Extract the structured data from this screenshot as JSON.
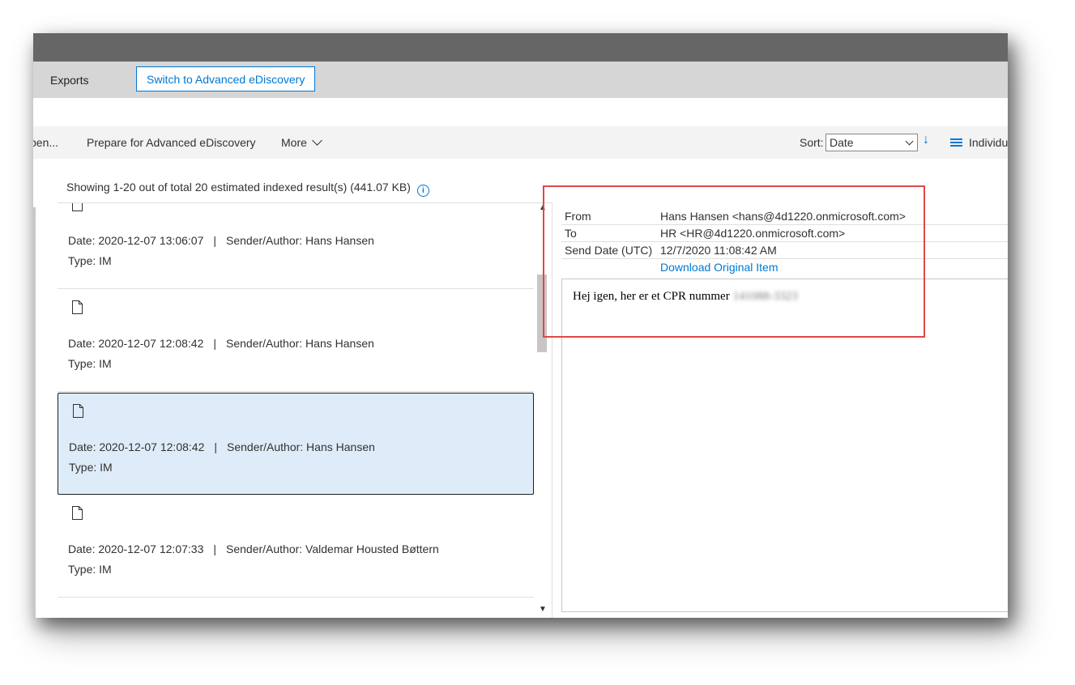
{
  "tabs": {
    "exports_label": "Exports",
    "switch_button_label": "Switch to Advanced eDiscovery"
  },
  "commands": {
    "open_label": "pen...",
    "prepare_label": "Prepare for Advanced eDiscovery",
    "more_label": "More",
    "sort_label": "Sort:",
    "sort_value": "Date",
    "view_label": "Individu"
  },
  "results": {
    "summary": "Showing 1-20 out of total 20 estimated indexed result(s) (441.07 KB)",
    "items": [
      {
        "meta_date": "Date: 2020-12-07 13:06:07",
        "sep": "|",
        "sender": "Sender/Author: Hans Hansen",
        "type": "Type: IM"
      },
      {
        "meta_date": "Date: 2020-12-07 12:08:42",
        "sep": "|",
        "sender": "Sender/Author: Hans Hansen",
        "type": "Type: IM"
      },
      {
        "meta_date": "Date: 2020-12-07 12:08:42",
        "sep": "|",
        "sender": "Sender/Author: Hans Hansen",
        "type": "Type: IM"
      },
      {
        "meta_date": "Date: 2020-12-07 12:07:33",
        "sep": "|",
        "sender": "Sender/Author: Valdemar Housted Bøttern",
        "type": "Type: IM"
      }
    ],
    "selected_index": 2
  },
  "preview": {
    "from_label": "From",
    "from_value": "Hans Hansen <hans@4d1220.onmicrosoft.com>",
    "to_label": "To",
    "to_value": "HR <HR@4d1220.onmicrosoft.com>",
    "send_date_label": "Send Date (UTC)",
    "send_date_value": "12/7/2020 11:08:42 AM",
    "download_label": "Download Original Item",
    "body_text": "Hej igen, her er et CPR nummer",
    "redacted_text": "141088-3323"
  },
  "colors": {
    "accent": "#0078d4",
    "selected_bg": "#deecf9",
    "highlight_border": "#e04848"
  }
}
